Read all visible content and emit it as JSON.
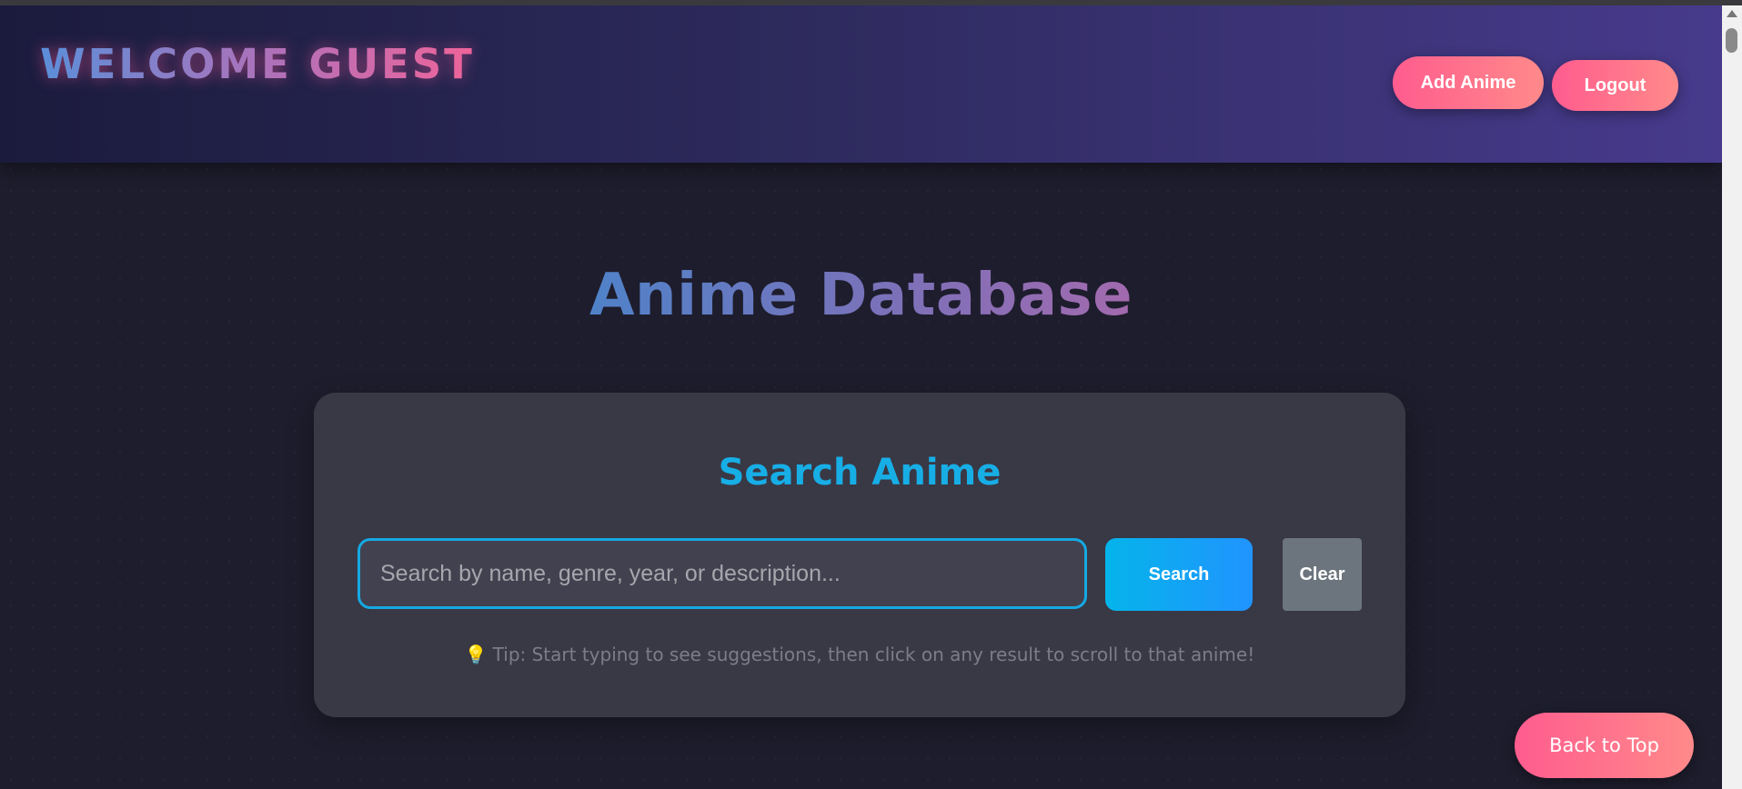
{
  "header": {
    "welcome": "WELCOME GUEST",
    "add_anime_label": "Add Anime",
    "logout_label": "Logout"
  },
  "main": {
    "title": "Anime Database"
  },
  "search": {
    "heading": "Search Anime",
    "placeholder": "Search by name, genre, year, or description...",
    "value": "",
    "search_label": "Search",
    "clear_label": "Clear",
    "tip_icon": "lightbulb-icon",
    "tip": "Tip: Start typing to see suggestions, then click on any result to scroll to that anime!"
  },
  "back_to_top_label": "Back to Top",
  "colors": {
    "header_start": "#1b1b3d",
    "header_end": "#473a8c",
    "pink_accent": "#ff5c8e",
    "cyan_accent": "#17aee6",
    "card_bg": "#393845",
    "page_bg": "#1e1d2d"
  }
}
